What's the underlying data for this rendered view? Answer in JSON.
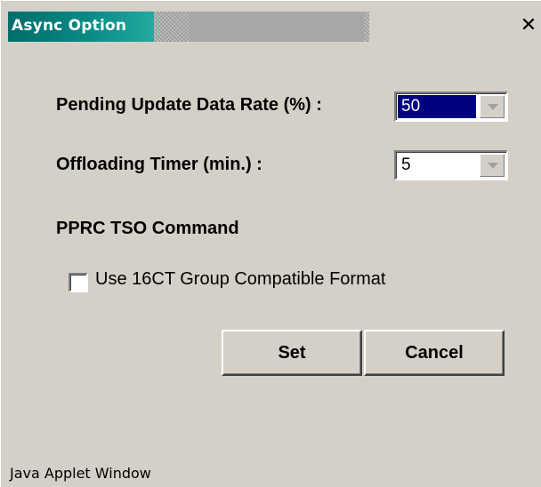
{
  "window": {
    "title": "Async Option",
    "close_glyph": "✕"
  },
  "form": {
    "pending_rate_label": "Pending Update Data Rate (%) :",
    "pending_rate_value": "50",
    "offloading_timer_label": "Offloading Timer (min.) :",
    "offloading_timer_value": "5",
    "section_heading": "PPRC TSO Command",
    "checkbox_label": "Use 16CT Group Compatible Format",
    "checkbox_checked": false
  },
  "buttons": {
    "set_label": "Set",
    "cancel_label": "Cancel"
  },
  "footer": {
    "text": "Java Applet Window"
  },
  "colors": {
    "title_active": "#006d6b",
    "selection": "#000080",
    "face": "#d4d0c8"
  },
  "icons": {
    "close": "close-icon",
    "dropdown": "chevron-down-icon"
  }
}
